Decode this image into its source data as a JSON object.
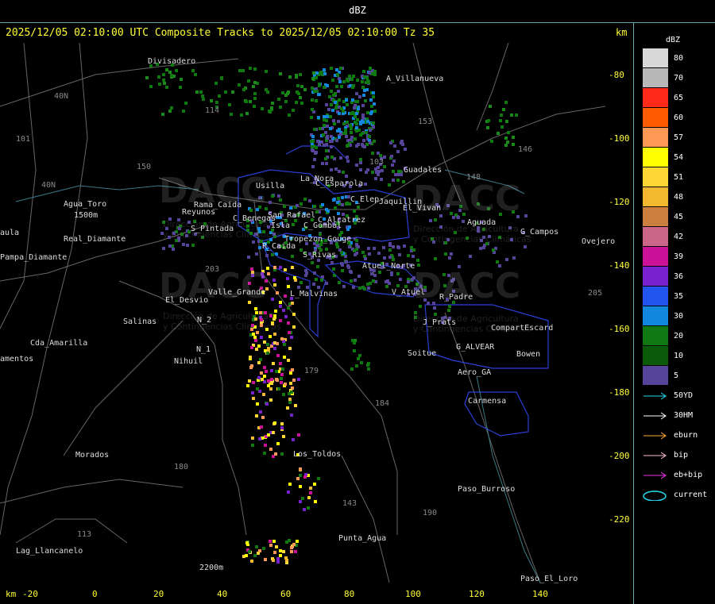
{
  "window": {
    "title": "dBZ"
  },
  "header": {
    "headline": "2025/12/05 02:10:00 UTC Composite Tracks to 2025/12/05 02:10:00 Tz 35",
    "unit_top": "km"
  },
  "axes": {
    "y_ticks": [
      "-80",
      "-100",
      "-120",
      "-140",
      "-160",
      "-180",
      "-200",
      "-220"
    ],
    "x_ticks": [
      "-20",
      "0",
      "20",
      "40",
      "60",
      "80",
      "100",
      "120",
      "140"
    ],
    "unit_bottom": "km"
  },
  "legend": {
    "title": "dBZ",
    "levels": [
      {
        "label": "80",
        "color": "#d8d8d8"
      },
      {
        "label": "70",
        "color": "#b8b8b8"
      },
      {
        "label": "65",
        "color": "#ff2a1a"
      },
      {
        "label": "60",
        "color": "#ff5a00"
      },
      {
        "label": "57",
        "color": "#ff9955"
      },
      {
        "label": "54",
        "color": "#ffff00"
      },
      {
        "label": "51",
        "color": "#ffd633"
      },
      {
        "label": "48",
        "color": "#f4b830"
      },
      {
        "label": "45",
        "color": "#cc8040"
      },
      {
        "label": "42",
        "color": "#cc6688"
      },
      {
        "label": "39",
        "color": "#cc1199"
      },
      {
        "label": "36",
        "color": "#7722cc"
      },
      {
        "label": "35",
        "color": "#2255ee"
      },
      {
        "label": "30",
        "color": "#1188dd"
      },
      {
        "label": "20",
        "color": "#117711"
      },
      {
        "label": "10",
        "color": "#0a5a0a"
      },
      {
        "label": "5",
        "color": "#55449a"
      }
    ],
    "tracks": [
      {
        "label": "50YD",
        "color": "#22ddee"
      },
      {
        "label": "30HM",
        "color": "#ffffff"
      },
      {
        "label": "eburn",
        "color": "#ffaa33"
      },
      {
        "label": "bip",
        "color": "#ffbbcc"
      },
      {
        "label": "eb+bip",
        "color": "#ee33ee"
      },
      {
        "label": "current",
        "color": "#22ddee"
      }
    ]
  },
  "watermark": {
    "brand": "DACC",
    "line1": "Dirección de Agricultura",
    "line2": "y Contingencias Climáticas"
  },
  "places": [
    "Divisadero",
    "A_Villanueva",
    "40N",
    "101",
    "Usilla",
    "La_Nora",
    "C_Esparola",
    "C_Elep",
    "Jaquillin",
    "Rama_Caida",
    "San_Rafael",
    "C_Alcatrez",
    "Reyunos",
    "S_Pintada",
    "C_Benegas",
    "Isla",
    "C_Gombal",
    "Guadales",
    "El_Vivan",
    "Aguada",
    "G_Campos",
    "Ovejero",
    "aula",
    "Pampa_Diamante",
    "Agua_Toro",
    "1500m",
    "Real_Diamante",
    "R_Caida",
    "Tropezon_Gouge",
    "S_Rivas",
    "Atuel_Norte",
    "V_Atuel",
    "R_Padre",
    "El_Desvio",
    "Valle_Grande",
    "L_Malvinas",
    "Salinas",
    "N_2",
    "N_1",
    "Nihuil",
    "Cda_Amarilla",
    "amentos",
    "J_Prats",
    "CompartEscard",
    "G_ALVEAR",
    "Soitue",
    "Bowen",
    "Aero_GA",
    "Carmensa",
    "Morados",
    "Los_Toldos",
    "Paso_Burroso",
    "Punta_Agua",
    "Lag_Llancanelo",
    "2200m",
    "Paso_El_Loro",
    "153",
    "146",
    "148",
    "103",
    "179",
    "184",
    "180",
    "143",
    "190",
    "113",
    "114",
    "203",
    "205",
    "150",
    "40N"
  ]
}
